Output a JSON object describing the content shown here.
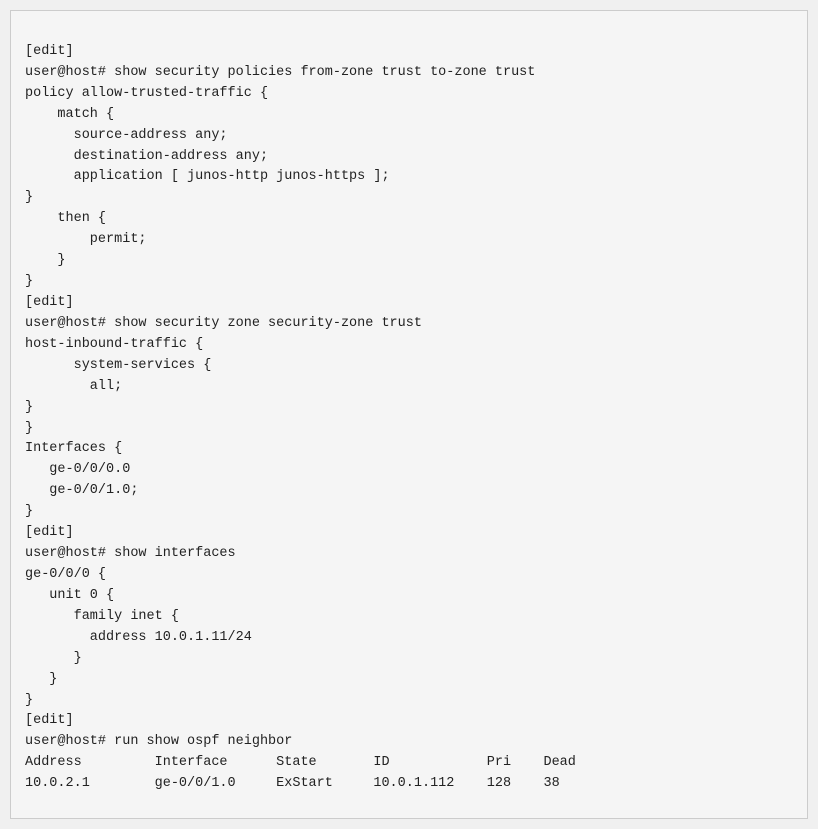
{
  "terminal": {
    "lines": [
      "[edit]",
      "user@host# show security policies from-zone trust to-zone trust",
      "policy allow-trusted-traffic {",
      "    match {",
      "      source-address any;",
      "      destination-address any;",
      "      application [ junos-http junos-https ];",
      "}",
      "    then {",
      "        permit;",
      "    }",
      "}",
      "[edit]",
      "user@host# show security zone security-zone trust",
      "host-inbound-traffic {",
      "      system-services {",
      "        all;",
      "}",
      "}",
      "Interfaces {",
      "   ge-0/0/0.0",
      "   ge-0/0/1.0;",
      "}",
      "[edit]",
      "user@host# show interfaces",
      "ge-0/0/0 {",
      "   unit 0 {",
      "      family inet {",
      "        address 10.0.1.11/24",
      "      }",
      "   }",
      "}",
      "[edit]",
      "user@host# run show ospf neighbor",
      "Address         Interface      State       ID            Pri    Dead",
      "10.0.2.1        ge-0/0/1.0     ExStart     10.0.1.112    128    38"
    ]
  }
}
